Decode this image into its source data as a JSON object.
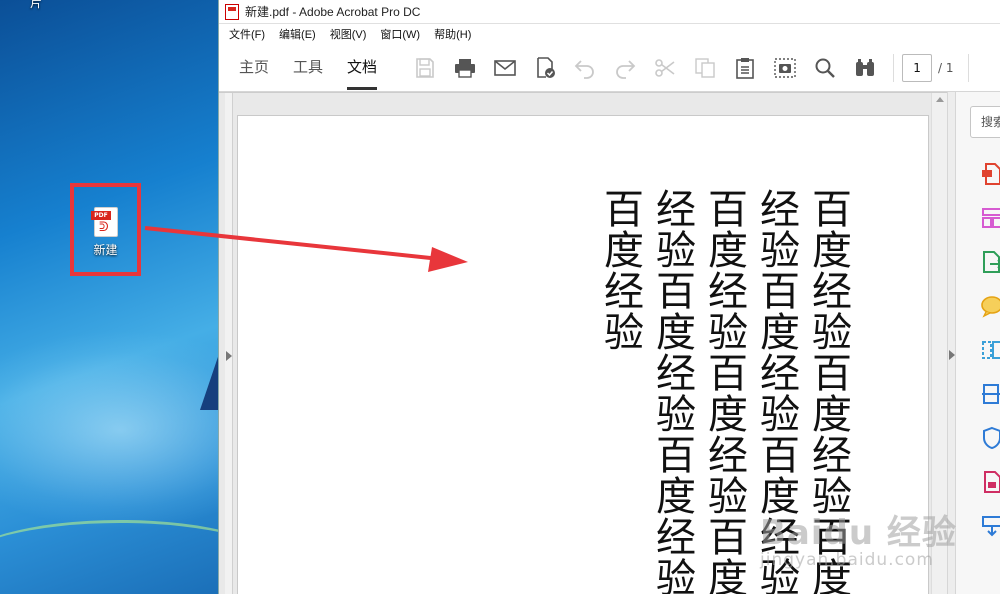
{
  "desktop": {
    "top_label": "片",
    "file_icon_label": "新建",
    "file_icon_tag": "PDF"
  },
  "window": {
    "title": "新建.pdf - Adobe Acrobat Pro DC"
  },
  "menu": [
    "文件(F)",
    "编辑(E)",
    "视图(V)",
    "窗口(W)",
    "帮助(H)"
  ],
  "tabs": [
    "主页",
    "工具",
    "文档"
  ],
  "active_tab": "文档",
  "toolbar_icons": [
    "save-icon",
    "print-icon",
    "email-icon",
    "sign-certify-icon",
    "undo-icon",
    "redo-icon",
    "cut-icon",
    "copy-icon",
    "paste-icon",
    "snapshot-icon",
    "find-icon",
    "binoculars-icon"
  ],
  "page_nav": {
    "current": "1",
    "total": "/ 1"
  },
  "document": {
    "vertical_text": "百度经验百度经验百度经验百度经验百度经验百度经验百度经验百度经验百度经验百度经验百度经验"
  },
  "right_pane": {
    "search_placeholder": "搜索",
    "tool_icons": [
      "create-pdf-icon",
      "organize-pages-icon",
      "export-pdf-icon",
      "comment-icon",
      "compare-icon",
      "scan-icon",
      "protect-icon",
      "edit-pdf-icon",
      "more-tools-icon"
    ],
    "tool_colors": [
      "#e0432f",
      "#d65bd1",
      "#2f9e59",
      "#e5a314",
      "#3aa0d8",
      "#2e7bd6",
      "#2e7bd6",
      "#cf2e63",
      "#2e7bd6"
    ]
  },
  "watermark": {
    "logo": "Baidu 经验",
    "url": "jingyan.baidu.com"
  },
  "colors": {
    "highlight_red": "#e8363b",
    "arrow_red": "#e8363b"
  }
}
